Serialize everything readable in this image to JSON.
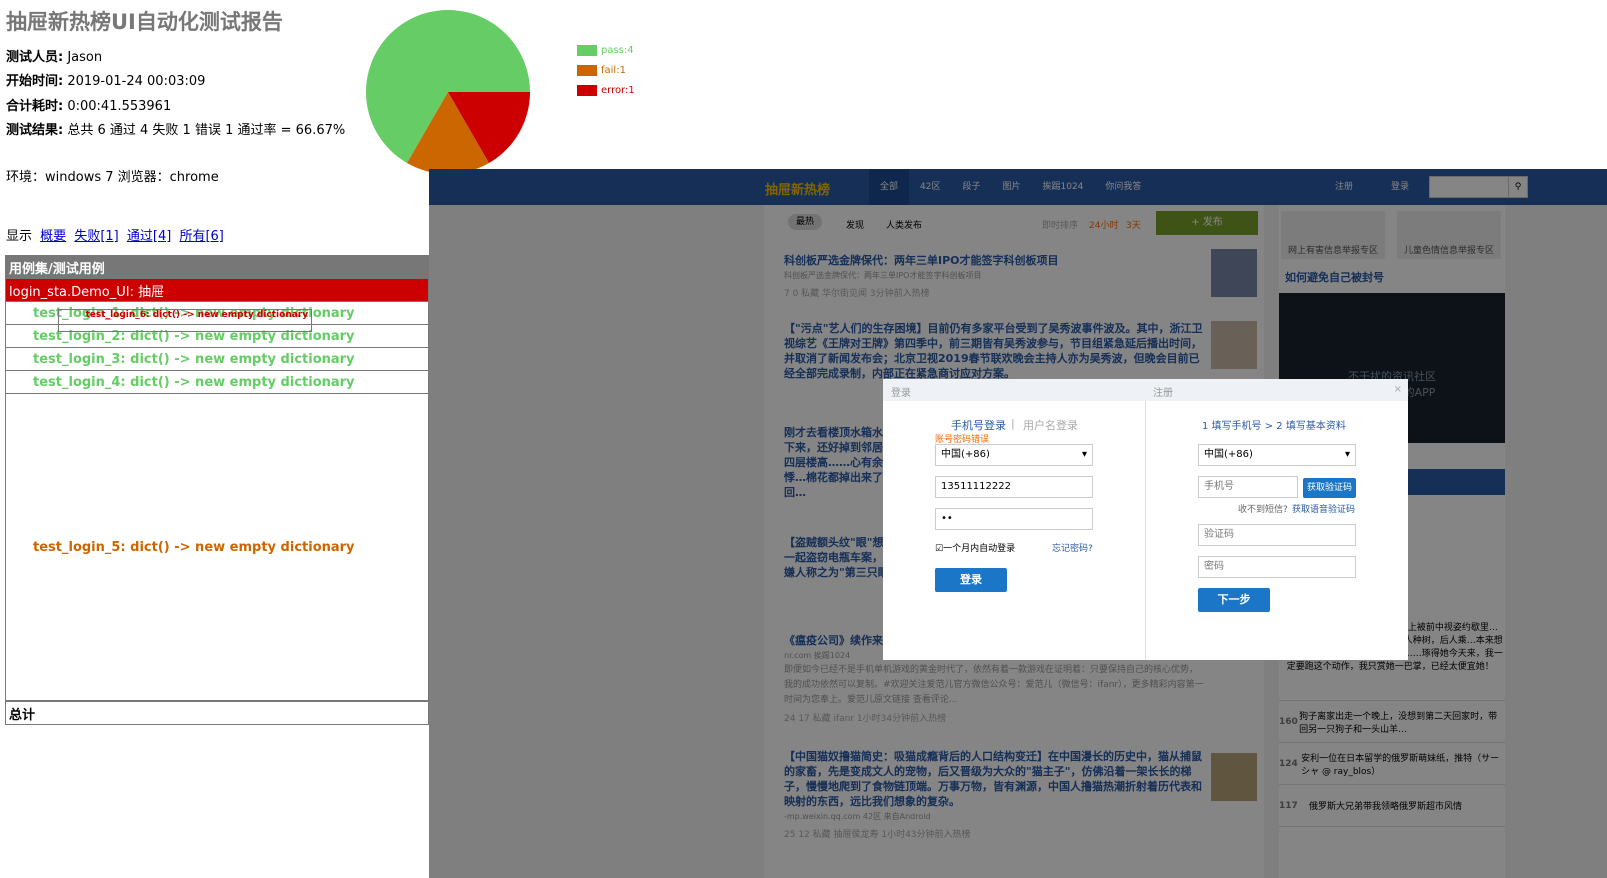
{
  "report": {
    "title": "抽屉新热榜UI自动化测试报告",
    "attributes": [
      {
        "label": "测试人员:",
        "value": "Jason"
      },
      {
        "label": "开始时间:",
        "value": "2019-01-24 00:03:09"
      },
      {
        "label": "合计耗时:",
        "value": "0:00:41.553961"
      },
      {
        "label": "测试结果:",
        "value": "总共 6 通过 4 失败 1 错误 1 通过率 = 66.67%"
      }
    ],
    "env": "环境：windows 7 浏览器：chrome",
    "show_label": "显示",
    "show_links": [
      "概要",
      "失败[1]",
      "通过[4]",
      "所有[6]"
    ]
  },
  "chart_data": {
    "type": "pie",
    "slices": [
      {
        "label": "pass:4",
        "value": 4,
        "color": "#66cc66"
      },
      {
        "label": "fail:1",
        "value": 1,
        "color": "#cc6600"
      },
      {
        "label": "error:1",
        "value": 1,
        "color": "#cc0000"
      }
    ]
  },
  "table": {
    "header": "用例集/测试用例",
    "class_row": "login_sta.Demo_UI: 抽屉",
    "cases": [
      {
        "name": "test_login_1: dict() -> new empty dictionary",
        "status": "pass"
      },
      {
        "name": "test_login_2: dict() -> new empty dictionary",
        "status": "pass"
      },
      {
        "name": "test_login_3: dict() -> new empty dictionary",
        "status": "pass"
      },
      {
        "name": "test_login_4: dict() -> new empty dictionary",
        "status": "pass"
      },
      {
        "name": "test_login_5: dict() -> new empty dictionary",
        "status": "fail"
      },
      {
        "name": "test_login_6: dict() -> new empty dictionary",
        "status": "error"
      }
    ],
    "total": "总计"
  },
  "shot": {
    "logo": "抽屉新热榜",
    "nav": [
      "全部",
      "42区",
      "段子",
      "图片",
      "挨踢1024",
      "你问我答"
    ],
    "register": "注册",
    "login": "登录",
    "toolbar": [
      "最热",
      "发现",
      "人类发布"
    ],
    "sort_label": "即时排序",
    "sort_24": "24小时",
    "sort_3": "3天",
    "publish": "+ 发布",
    "news": [
      {
        "title": "科创板严选金牌保代：两年三单IPO才能签字科创板项目",
        "src": "-awtmt.com  42区",
        "desc": "科创板严选金牌保代：两年三单IPO才能签字科创板项目",
        "meta": "7   0   私藏   华尔街见闻   3分钟前入热榜"
      },
      {
        "title": "【\"污点\"艺人们的生存困境】目前仍有多家平台受到了吴秀波事件波及。其中，浙江卫视综艺《王牌对王牌》第四季中，前三期皆有吴秀波参与，节目组紧急延后播出时间，并取消了新闻发布会；北京卫视2019春节联欢晚会主持人亦为吴秀波，但晚会目前已经全部完成录制，内部正在紧急商讨应对方案。",
        "src": "-yuanchuang.caijing.com.cn",
        "desc": "",
        "meta": "20   0"
      },
      {
        "title": "刚才去看楼顶水箱水…下来，还好掉到邻居…四层楼高……心有余悸…棉花都掉出来了。回…",
        "src": "来自Android  我的生…",
        "desc": "",
        "meta": "66   125"
      },
      {
        "title": "【盗贼额头纹\"眼\"想…一起盗窃电瓶车案，…嫌人称之为\"第三只眼…",
        "src": "ews.163.com  42区",
        "desc": "",
        "meta": "16   25"
      },
      {
        "title": "《瘟疫公司》续作来…",
        "src": "nr.com  挨踢1024",
        "desc": "即便如今已经不是手机单机游戏的黄金时代了，依然有着一款游戏在证明着：只要保持自己的核心优势，我的成功依然可以复制。#欢迎关注爱范儿官方微信公众号：爱范儿（微信号：ifanr），更多精彩内容第一时间为您奉上。爱范儿原文链接 查看评论...",
        "meta": "24   17   私藏   ifanr   1小时34分钟前入热榜"
      },
      {
        "title": "【中国猫奴撸猫简史：吸猫成瘾背后的人口结构变迁】在中国漫长的历史中，猫从捕鼠的家畜，先是变成文人的宠物，后又晋级为大众的\"猫主子\"，仿佛沿着一架长长的梯子，慢慢地爬到了食物链顶端。万事万物，皆有渊源，中国人撸猫热潮折射着历代表和映射的东西，远比我们想象的复杂。",
        "src": "-mp.weixin.qq.com  42区  来自Android",
        "desc": "",
        "meta": "25   12   私藏   抽屉侯龙寿   1小时43分钟前入热榜"
      }
    ],
    "side_boxes": [
      "网上有害信息举报专区",
      "儿童色情信息举报专区"
    ],
    "side_hint": "如何避免自己被封号",
    "side_dark": "不干扰的资讯社区",
    "side_dark2": "抽屉新热榜的APP",
    "ranks": [
      {
        "n": "",
        "t": "人当众后巴革】台\"文化…议会上被前中视姿约歇里…中表示：因为她描战痞…，前人种树，后人乘…本来想要宽她两巴掌，…了好几个月……琢得她今天来，我一定要跑这个动作，我只赏她一巴掌，已经太便宜她！"
      },
      {
        "n": "160",
        "t": "狗子离家出走一个晚上，没想到第二天回家时，带回另一只狗子和一头山羊…"
      },
      {
        "n": "124",
        "t": "安利一位在日本留学的俄罗斯萌妹纸，推特（サーシャ @ ray_blos）"
      },
      {
        "n": "117",
        "t": "俄罗斯大兄弟带我领略俄罗斯超市风情"
      }
    ],
    "modal": {
      "login_title": "登录",
      "register_title": "注册",
      "close": "×",
      "tab_phone": "手机号登录",
      "tab_sep": "|",
      "tab_user": "用户名登录",
      "error": "账号密码错误",
      "country": "中国(+86)",
      "phone_value": "13511112222",
      "password_value": "••",
      "auto_login": "一个月内自动登录",
      "forgot": "忘记密码?",
      "login_btn": "登录",
      "reg_steps": "1 填写手机号 > 2 填写基本资料",
      "reg_country": "中国(+86)",
      "reg_phone_ph": "手机号",
      "get_code": "获取验证码",
      "no_sms": "收不到短信?",
      "voice_code": "获取语音验证码",
      "code_ph": "验证码",
      "pwd_ph": "密码",
      "next_btn": "下一步"
    }
  }
}
